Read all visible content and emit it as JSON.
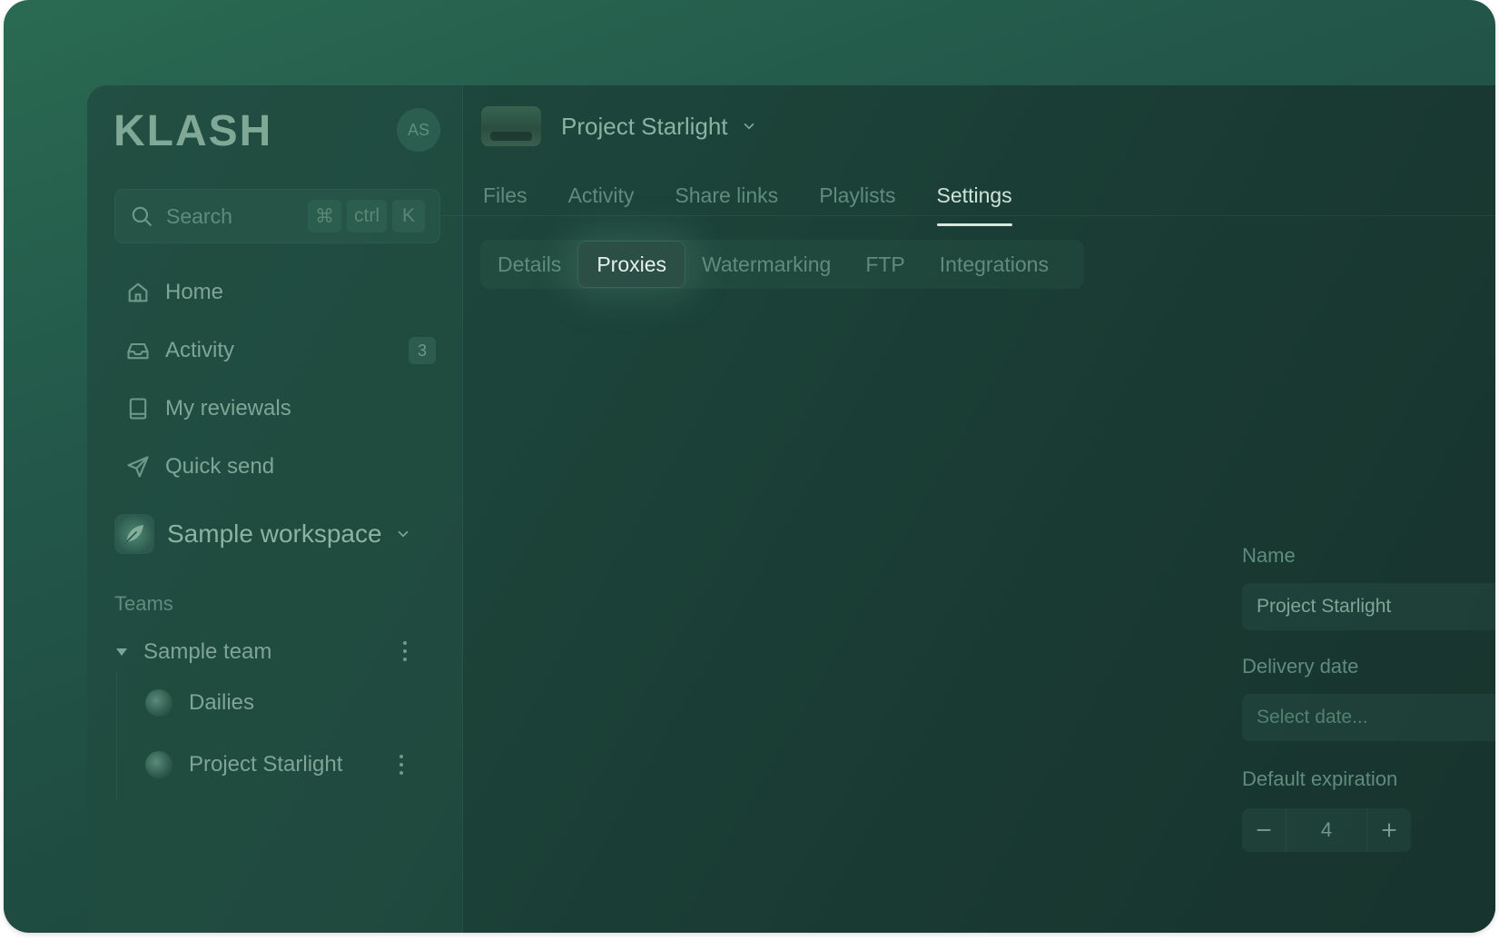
{
  "brand": {
    "logo_text": "KLASH"
  },
  "user": {
    "initials": "AS"
  },
  "search": {
    "placeholder": "Search",
    "shortcut": [
      "⌘",
      "ctrl",
      "K"
    ]
  },
  "nav": {
    "items": [
      {
        "label": "Home",
        "icon": "home-icon"
      },
      {
        "label": "Activity",
        "icon": "inbox-icon",
        "badge": "3"
      },
      {
        "label": "My reviewals",
        "icon": "book-icon"
      },
      {
        "label": "Quick send",
        "icon": "send-icon"
      }
    ]
  },
  "workspace": {
    "name": "Sample workspace"
  },
  "teams": {
    "label": "Teams",
    "team_name": "Sample team",
    "projects": [
      {
        "name": "Dailies"
      },
      {
        "name": "Project Starlight"
      }
    ]
  },
  "header": {
    "project_title": "Project Starlight"
  },
  "tabs": [
    {
      "label": "Files"
    },
    {
      "label": "Activity"
    },
    {
      "label": "Share links"
    },
    {
      "label": "Playlists"
    },
    {
      "label": "Settings",
      "active": true
    }
  ],
  "subtabs": [
    {
      "label": "Details"
    },
    {
      "label": "Proxies",
      "active": true
    },
    {
      "label": "Watermarking"
    },
    {
      "label": "FTP"
    },
    {
      "label": "Integrations"
    }
  ],
  "form": {
    "name_label": "Name",
    "name_value": "Project Starlight",
    "delivery_label": "Delivery date",
    "delivery_placeholder": "Select date...",
    "expiration_label": "Default expiration",
    "expiration_value": "4"
  },
  "colors": {
    "accent_active_tab": "#d7e8df",
    "background": "#1c4339"
  }
}
